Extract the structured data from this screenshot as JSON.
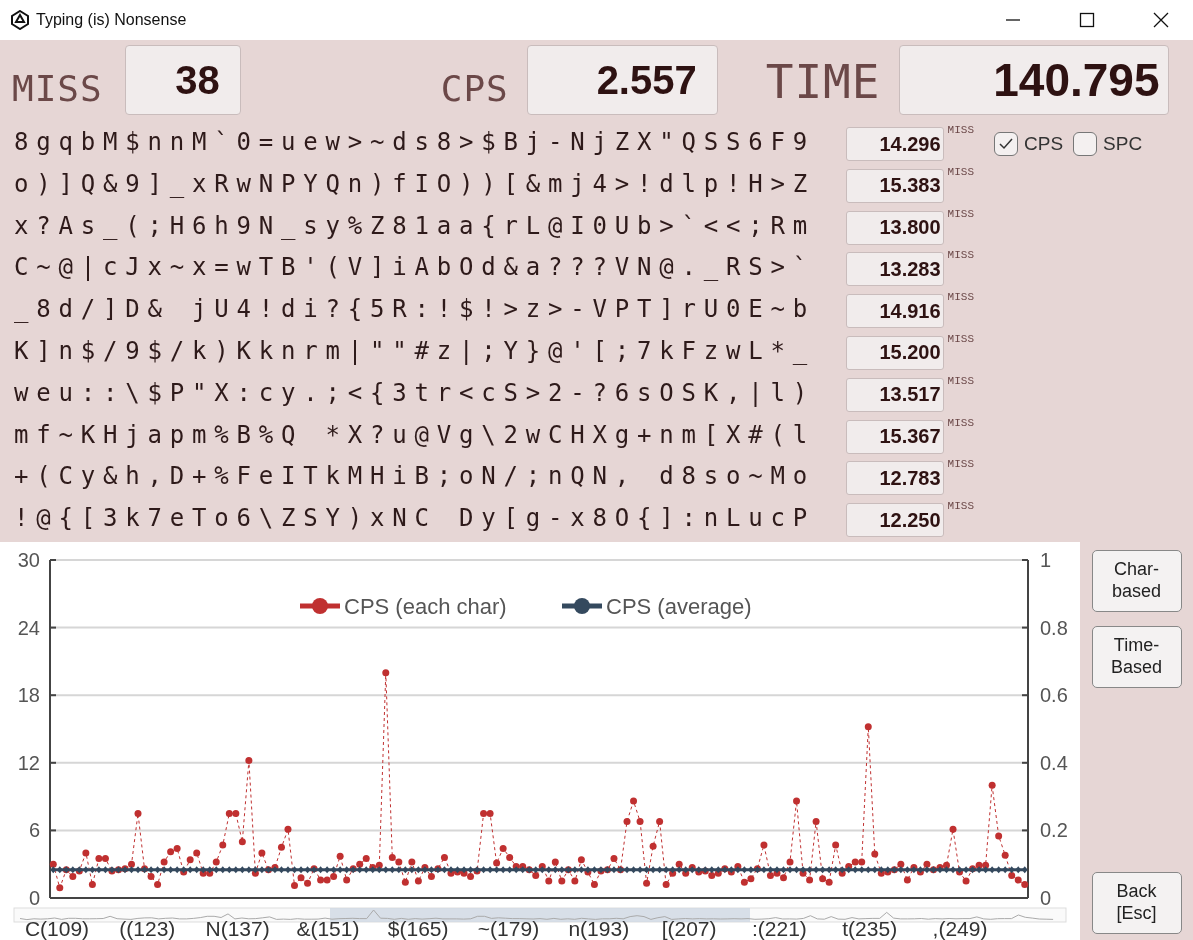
{
  "window": {
    "title": "Typing (is) Nonsense"
  },
  "stats": [
    {
      "label": "MISS",
      "value": "38"
    },
    {
      "label": "CPS",
      "value": "2.557"
    },
    {
      "label": "TIME",
      "value": "140.795"
    }
  ],
  "lines": [
    {
      "text": "8gqbM$nnM`0=uew>~ds8>$Bj-NjZX\"QSS6F9",
      "time": "14.296",
      "miss_label": "MISS"
    },
    {
      "text": "o)]Q&9]_xRwNPYQn)fIO))[&mj4>!dlp!H>Z",
      "time": "15.383",
      "miss_label": "MISS"
    },
    {
      "text": "x?As_(;H6h9N_sy%Z81aa{rL@I0Ub>`<<;Rm",
      "time": "13.800",
      "miss_label": "MISS"
    },
    {
      "text": "C~@|cJx~x=wTB'(V]iAbOd&a???VN@._RS>`",
      "time": "13.283",
      "miss_label": "MISS"
    },
    {
      "text": "_8d/]D& jU4!di?{5R:!$!>z>-VPT]rU0E~b",
      "time": "14.916",
      "miss_label": "MISS"
    },
    {
      "text": "K]n$/9$/k)Kknrm|\"\"#z|;Y}@'[;7kFzwL*_",
      "time": "15.200",
      "miss_label": "MISS"
    },
    {
      "text": "weu::\\$P\"X:cy.;<{3tr<cS>2-?6sOSK,|l)",
      "time": "13.517",
      "miss_label": "MISS"
    },
    {
      "text": "mf~KHjapm%B%Q *X?u@Vg\\2wCHXg+nm[X#(l",
      "time": "15.367",
      "miss_label": "MISS"
    },
    {
      "text": "+(Cy&h,D+%FeITkMHiB;oN/;nQN, d8so~Mo",
      "time": "12.783",
      "miss_label": "MISS"
    },
    {
      "text": "!@{[3k7eTo6\\ZSY)xNC Dy[g-x8O{]:nLucP",
      "time": "12.250",
      "miss_label": "MISS"
    }
  ],
  "toggles": [
    {
      "label": "CPS",
      "checked": true
    },
    {
      "label": "SPC",
      "checked": false
    }
  ],
  "chart": {
    "chart_data": {
      "type": "line",
      "ylim": [
        0,
        30
      ],
      "yticks": [
        0,
        6,
        12,
        18,
        24,
        30
      ],
      "y2lim": [
        0,
        1
      ],
      "y2ticks": [
        0,
        0.2,
        0.4,
        0.6,
        0.8,
        1
      ],
      "grid": true,
      "legend": true,
      "series": [
        {
          "name": "CPS (each char)",
          "color": "#c03030",
          "line_style": "dashed",
          "marker": "circle",
          "values": [
            3,
            0.9,
            2.5,
            1.9,
            2.4,
            4,
            1.2,
            3.5,
            3.5,
            2.4,
            2.5,
            2.6,
            3,
            7.5,
            2.6,
            1.9,
            1.2,
            3.2,
            4.1,
            4.4,
            2.3,
            3.4,
            4,
            2.2,
            2.2,
            3.2,
            4.7,
            7.5,
            7.5,
            5,
            12.2,
            2.2,
            4,
            2.5,
            2.7,
            4.5,
            6.1,
            1.1,
            1.8,
            1.3,
            2.6,
            1.6,
            1.6,
            1.9,
            3.7,
            1.6,
            2.6,
            3,
            3.5,
            2.7,
            2.9,
            20,
            3.6,
            3.2,
            1.4,
            3.2,
            1.5,
            2.7,
            1.9,
            2.6,
            3.6,
            2.2,
            2.3,
            2.2,
            1.9,
            2.4,
            7.5,
            7.5,
            3.1,
            4.4,
            3.6,
            2.8,
            2.8,
            2.5,
            2,
            2.8,
            1.5,
            3.2,
            1.5,
            2.5,
            1.5,
            3.4,
            2.3,
            1.2,
            2.4,
            2.5,
            3.5,
            2.5,
            6.8,
            8.6,
            6.8,
            1.3,
            4.6,
            6.8,
            1.2,
            2.2,
            3,
            2.2,
            2.7,
            2.3,
            2.4,
            2,
            2.2,
            2.6,
            2.3,
            2.8,
            1.4,
            1.7,
            2.6,
            4.7,
            2,
            2.2,
            1.8,
            3.2,
            8.6,
            2.2,
            1.6,
            6.8,
            1.7,
            1.4,
            4.7,
            2.2,
            2.8,
            3.2,
            3.2,
            15.2,
            3.9,
            2.2,
            2.3,
            2.5,
            3,
            1.6,
            2.7,
            2.3,
            3,
            2.5,
            2.7,
            2.9,
            6.1,
            2.3,
            1.5,
            2.6,
            2.9,
            2.9,
            10,
            5.5,
            3.8,
            2,
            1.6,
            1.2
          ]
        },
        {
          "name": "CPS (average)",
          "color": "#34495e",
          "line_style": "solid",
          "marker": "diamond",
          "values": [
            2.5,
            2.5,
            2.5,
            2.5,
            2.5,
            2.5,
            2.5,
            2.5,
            2.5,
            2.5,
            2.5,
            2.5,
            2.5,
            2.5,
            2.5,
            2.5,
            2.5,
            2.5,
            2.5,
            2.5,
            2.5,
            2.5,
            2.5,
            2.5,
            2.5,
            2.5,
            2.5,
            2.5,
            2.5,
            2.5,
            2.5,
            2.5,
            2.5,
            2.5,
            2.5,
            2.5,
            2.5,
            2.5,
            2.5,
            2.5,
            2.5,
            2.5,
            2.5,
            2.5,
            2.5,
            2.5,
            2.5,
            2.5,
            2.5,
            2.5,
            2.5,
            2.5,
            2.5,
            2.5,
            2.5,
            2.5,
            2.5,
            2.5,
            2.5,
            2.5,
            2.5,
            2.5,
            2.5,
            2.5,
            2.5,
            2.5,
            2.5,
            2.5,
            2.5,
            2.5,
            2.5,
            2.5,
            2.5,
            2.5,
            2.5,
            2.5,
            2.5,
            2.5,
            2.5,
            2.5,
            2.5,
            2.5,
            2.5,
            2.5,
            2.5,
            2.5,
            2.5,
            2.5,
            2.5,
            2.5,
            2.5,
            2.5,
            2.5,
            2.5,
            2.5,
            2.5,
            2.5,
            2.5,
            2.5,
            2.5,
            2.5,
            2.5,
            2.5,
            2.5,
            2.5,
            2.5,
            2.5,
            2.5,
            2.5,
            2.5,
            2.5,
            2.5,
            2.5,
            2.5,
            2.5,
            2.5,
            2.5,
            2.5,
            2.5,
            2.5,
            2.5,
            2.5,
            2.5,
            2.5,
            2.5,
            2.5,
            2.5,
            2.5,
            2.5,
            2.5,
            2.5,
            2.5,
            2.5,
            2.5,
            2.5,
            2.5,
            2.5,
            2.5,
            2.5,
            2.5,
            2.5,
            2.5,
            2.5,
            2.5,
            2.5,
            2.5,
            2.5,
            2.5,
            2.5,
            2.5
          ]
        }
      ]
    },
    "navigator_labels": [
      "C(109)",
      "((123)",
      "N(137)",
      "&(151)",
      "$(165)",
      "~(179)",
      "n(193)",
      "[(207)",
      ":(221)",
      "t(235)",
      ",(249)"
    ]
  },
  "buttons": [
    "Char-based",
    "Time-Based"
  ],
  "back_button": "Back [Esc]"
}
